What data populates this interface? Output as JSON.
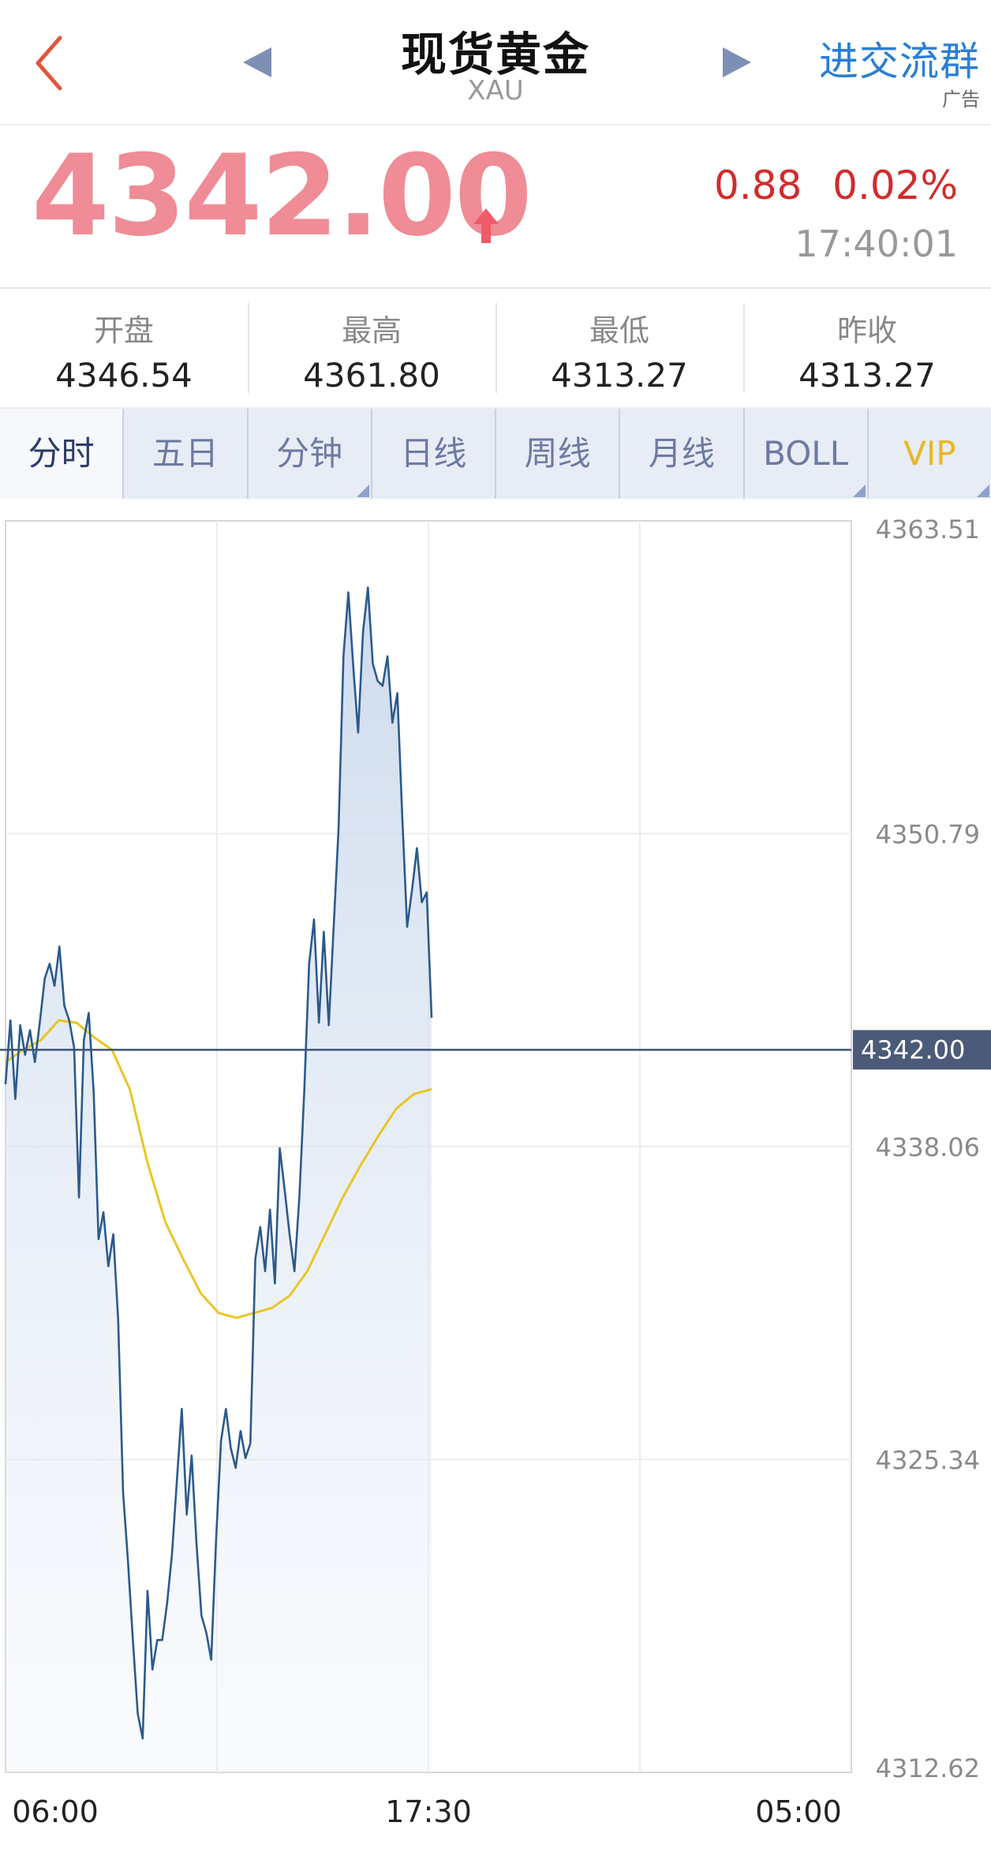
{
  "header": {
    "title": "现货黄金",
    "symbol": "XAU",
    "ad_link": "进交流群",
    "ad_tag": "广告"
  },
  "quote": {
    "price": "4342.00",
    "change": "0.88",
    "change_pct": "0.02%",
    "time": "17:40:01"
  },
  "stats": [
    {
      "label": "开盘",
      "value": "4346.54"
    },
    {
      "label": "最高",
      "value": "4361.80"
    },
    {
      "label": "最低",
      "value": "4313.27"
    },
    {
      "label": "昨收",
      "value": "4313.27"
    }
  ],
  "tabs": [
    "分时",
    "五日",
    "分钟",
    "日线",
    "周线",
    "月线",
    "BOLL",
    "VIP"
  ],
  "colors": {
    "price": "#ef8c95",
    "change": "#d12c2c",
    "line": "#2c5a8c",
    "avg": "#e8c626",
    "vip": "#e8b822",
    "link": "#2a7fd4"
  },
  "chart_data": {
    "type": "line",
    "y_ticks": [
      "4363.51",
      "4350.79",
      "4338.06",
      "4325.34",
      "4312.62"
    ],
    "ylim": [
      4312.62,
      4363.51
    ],
    "current_label": "4342.00",
    "current_value": 4342.0,
    "x_ticks": [
      "06:00",
      "17:30",
      "05:00"
    ],
    "grid": true,
    "series": [
      {
        "values": [
          4340.6,
          4343.2,
          4340.0,
          4343.0,
          4341.8,
          4342.8,
          4341.5,
          4343.1,
          4344.9,
          4345.5,
          4344.6,
          4346.2,
          4343.8,
          4343.2,
          4342.1,
          4336.0,
          4342.4,
          4343.5,
          4340.3,
          4334.3,
          4335.4,
          4333.2,
          4334.5,
          4331.0,
          4324.0,
          4321.2,
          4318.0,
          4315.0,
          4314.0,
          4320.0,
          4316.8,
          4318.0,
          4318.0,
          4319.5,
          4321.5,
          4324.5,
          4327.4,
          4323.1,
          4325.5,
          4321.9,
          4319.0,
          4318.3,
          4317.2,
          4322.1,
          4326.1,
          4327.4,
          4325.8,
          4325.0,
          4326.5,
          4325.4,
          4326.0,
          4333.5,
          4334.8,
          4333.0,
          4335.5,
          4332.5,
          4338.0,
          4336.3,
          4334.5,
          4333.0,
          4336.0,
          4340.3,
          4345.5,
          4347.3,
          4343.1,
          4346.8,
          4343.0,
          4347.0,
          4351.0,
          4358.0,
          4360.6,
          4357.6,
          4354.9,
          4359.0,
          4360.8,
          4357.7,
          4357.0,
          4356.8,
          4358.0,
          4355.3,
          4356.5,
          4351.5,
          4347.0,
          4348.5,
          4350.2,
          4348.0,
          4348.4,
          4343.3
        ]
      },
      {
        "values": [
          4341.5,
          4342.0,
          4342.4,
          4343.2,
          4343.1,
          4342.5,
          4342.0,
          4340.4,
          4337.4,
          4335.0,
          4333.5,
          4332.1,
          4331.3,
          4331.1,
          4331.3,
          4331.5,
          4332.0,
          4333.0,
          4334.5,
          4336.0,
          4337.3,
          4338.5,
          4339.6,
          4340.2,
          4340.4
        ]
      }
    ]
  }
}
